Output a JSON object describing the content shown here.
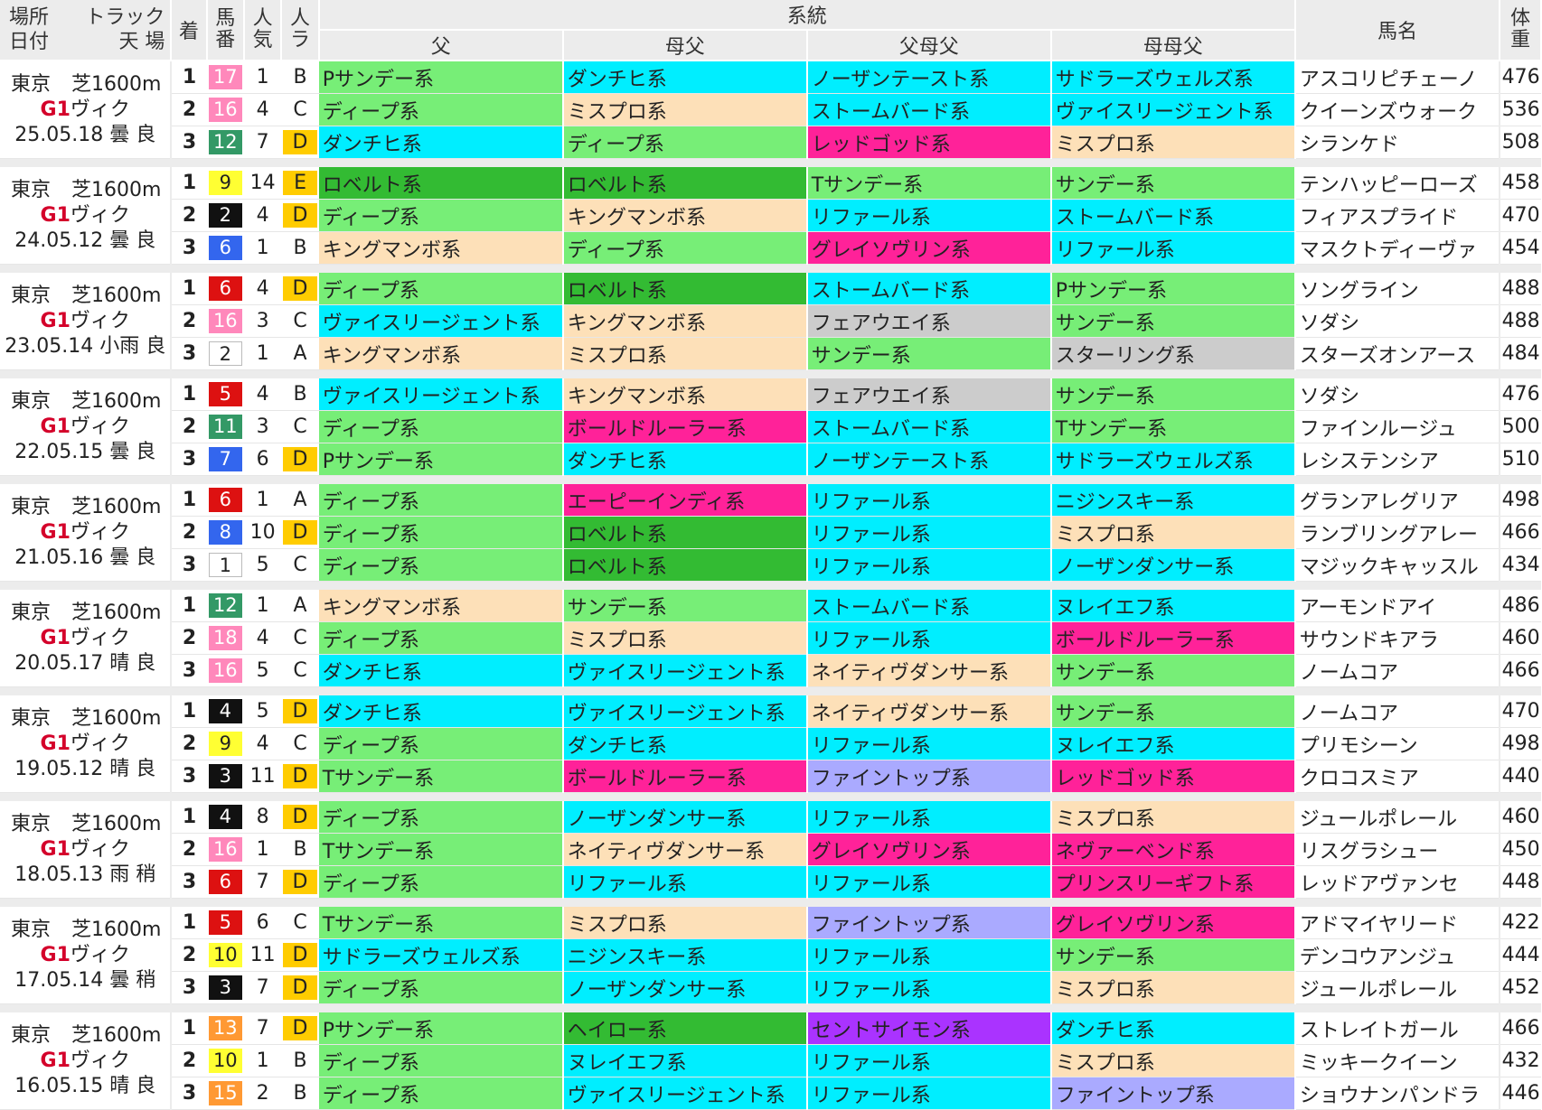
{
  "header": {
    "place": "場所",
    "track": "トラック",
    "date": "日付",
    "weather_ground": "天 場",
    "chaku": "着",
    "umaban": [
      "馬",
      "番"
    ],
    "ninki": [
      "人",
      "気"
    ],
    "nra": [
      "人",
      "ラ"
    ],
    "keito": "系統",
    "father": "父",
    "mother_father": "母父",
    "father_mother_father": "父母父",
    "mother_mother_father": "母母父",
    "horse_name": "馬名",
    "weight": [
      "体",
      "重"
    ]
  },
  "colors": {
    "ディープ系": "#77ee77",
    "ダンチヒ系": "#00eeff",
    "ロベルト系": "#33bb33",
    "キングマンボ系": "#fde0b8",
    "ヴァイスリージェント系": "#00eeff",
    "Pサンデー系": "#77ee77",
    "Tサンデー系": "#77ee77",
    "サドラーズウェルズ系": "#00eeff",
    "ミスプロ系": "#fde0b8",
    "ボールドルーラー系": "#ff2299",
    "エーピーインディ系": "#ff2299",
    "サンデー系": "#77ee77",
    "ネイティヴダンサー系": "#fde0b8",
    "ノーザンダンサー系": "#00eeff",
    "リファール系": "#00eeff",
    "ニジンスキー系": "#00eeff",
    "ヘイロー系": "#33bb33",
    "ヌレイエフ系": "#00eeff",
    "ノーザンテースト系": "#00eeff",
    "ストームバード系": "#00eeff",
    "レッドゴッド系": "#ff2299",
    "グレイソヴリン系": "#ff2299",
    "フェアウエイ系": "#cccccc",
    "スターリング系": "#cccccc",
    "ファイントップ系": "#aaaaff",
    "セントサイモン系": "#aa33ff",
    "ネヴァーベンド系": "#ff2299",
    "プリンスリーギフト系": "#ff2299"
  },
  "gate_colors": {
    "1": "#ffffff",
    "2": "#111111",
    "3": "#dd1111",
    "4": "#3366ee",
    "5": "#ffff33",
    "6": "#339966",
    "7": "#ff9933",
    "8": "#ff88bb"
  },
  "ra_color": "#ffcc00",
  "races": [
    {
      "place": "東京",
      "track": "芝1600m",
      "grade": "G1",
      "name": "ヴィク",
      "date": "25.05.18",
      "weather": "曇",
      "ground": "良",
      "rows": [
        {
          "chaku": "1",
          "uma": "17",
          "gate": "8",
          "ninki": "1",
          "ra": "B",
          "f": "Pサンデー系",
          "mf": "ダンチヒ系",
          "fmf": "ノーザンテースト系",
          "mmf": "サドラーズウェルズ系",
          "horse": "アスコリピチェーノ",
          "wt": "476"
        },
        {
          "chaku": "2",
          "uma": "16",
          "gate": "8",
          "ninki": "4",
          "ra": "C",
          "f": "ディープ系",
          "mf": "ミスプロ系",
          "fmf": "ストームバード系",
          "mmf": "ヴァイスリージェント系",
          "horse": "クイーンズウォーク",
          "wt": "536"
        },
        {
          "chaku": "3",
          "uma": "12",
          "gate": "6",
          "ninki": "7",
          "ra": "D",
          "f": "ダンチヒ系",
          "mf": "ディープ系",
          "fmf": "レッドゴッド系",
          "mmf": "ミスプロ系",
          "horse": "シランケド",
          "wt": "508"
        }
      ]
    },
    {
      "place": "東京",
      "track": "芝1600m",
      "grade": "G1",
      "name": "ヴィク",
      "date": "24.05.12",
      "weather": "曇",
      "ground": "良",
      "rows": [
        {
          "chaku": "1",
          "uma": "9",
          "gate": "5",
          "ninki": "14",
          "ra": "E",
          "f": "ロベルト系",
          "mf": "ロベルト系",
          "fmf": "Tサンデー系",
          "mmf": "サンデー系",
          "horse": "テンハッピーローズ",
          "wt": "458"
        },
        {
          "chaku": "2",
          "uma": "2",
          "gate": "2",
          "ninki": "4",
          "ra": "D",
          "f": "ディープ系",
          "mf": "キングマンボ系",
          "fmf": "リファール系",
          "mmf": "ストームバード系",
          "horse": "フィアスプライド",
          "wt": "470"
        },
        {
          "chaku": "3",
          "uma": "6",
          "gate": "4",
          "ninki": "1",
          "ra": "B",
          "f": "キングマンボ系",
          "mf": "ディープ系",
          "fmf": "グレイソヴリン系",
          "mmf": "リファール系",
          "horse": "マスクトディーヴァ",
          "wt": "454"
        }
      ]
    },
    {
      "place": "東京",
      "track": "芝1600m",
      "grade": "G1",
      "name": "ヴィク",
      "date": "23.05.14",
      "weather": "小雨",
      "ground": "良",
      "rows": [
        {
          "chaku": "1",
          "uma": "6",
          "gate": "3",
          "ninki": "4",
          "ra": "D",
          "f": "ディープ系",
          "mf": "ロベルト系",
          "fmf": "ストームバード系",
          "mmf": "Pサンデー系",
          "horse": "ソングライン",
          "wt": "488"
        },
        {
          "chaku": "2",
          "uma": "16",
          "gate": "8",
          "ninki": "3",
          "ra": "C",
          "f": "ヴァイスリージェント系",
          "mf": "キングマンボ系",
          "fmf": "フェアウエイ系",
          "mmf": "サンデー系",
          "horse": "ソダシ",
          "wt": "488"
        },
        {
          "chaku": "3",
          "uma": "2",
          "gate": "1",
          "ninki": "1",
          "ra": "A",
          "f": "キングマンボ系",
          "mf": "ミスプロ系",
          "fmf": "サンデー系",
          "mmf": "スターリング系",
          "horse": "スターズオンアース",
          "wt": "484"
        }
      ]
    },
    {
      "place": "東京",
      "track": "芝1600m",
      "grade": "G1",
      "name": "ヴィク",
      "date": "22.05.15",
      "weather": "曇",
      "ground": "良",
      "rows": [
        {
          "chaku": "1",
          "uma": "5",
          "gate": "3",
          "ninki": "4",
          "ra": "B",
          "f": "ヴァイスリージェント系",
          "mf": "キングマンボ系",
          "fmf": "フェアウエイ系",
          "mmf": "サンデー系",
          "horse": "ソダシ",
          "wt": "476"
        },
        {
          "chaku": "2",
          "uma": "11",
          "gate": "6",
          "ninki": "3",
          "ra": "C",
          "f": "ディープ系",
          "mf": "ボールドルーラー系",
          "fmf": "ストームバード系",
          "mmf": "Tサンデー系",
          "horse": "ファインルージュ",
          "wt": "500"
        },
        {
          "chaku": "3",
          "uma": "7",
          "gate": "4",
          "ninki": "6",
          "ra": "D",
          "f": "Pサンデー系",
          "mf": "ダンチヒ系",
          "fmf": "ノーザンテースト系",
          "mmf": "サドラーズウェルズ系",
          "horse": "レシステンシア",
          "wt": "510"
        }
      ]
    },
    {
      "place": "東京",
      "track": "芝1600m",
      "grade": "G1",
      "name": "ヴィク",
      "date": "21.05.16",
      "weather": "曇",
      "ground": "良",
      "rows": [
        {
          "chaku": "1",
          "uma": "6",
          "gate": "3",
          "ninki": "1",
          "ra": "A",
          "f": "ディープ系",
          "mf": "エーピーインディ系",
          "fmf": "リファール系",
          "mmf": "ニジンスキー系",
          "horse": "グランアレグリア",
          "wt": "498"
        },
        {
          "chaku": "2",
          "uma": "8",
          "gate": "4",
          "ninki": "10",
          "ra": "D",
          "f": "ディープ系",
          "mf": "ロベルト系",
          "fmf": "リファール系",
          "mmf": "ミスプロ系",
          "horse": "ランブリングアレー",
          "wt": "466"
        },
        {
          "chaku": "3",
          "uma": "1",
          "gate": "1",
          "ninki": "5",
          "ra": "C",
          "f": "ディープ系",
          "mf": "ロベルト系",
          "fmf": "リファール系",
          "mmf": "ノーザンダンサー系",
          "horse": "マジックキャッスル",
          "wt": "434"
        }
      ]
    },
    {
      "place": "東京",
      "track": "芝1600m",
      "grade": "G1",
      "name": "ヴィク",
      "date": "20.05.17",
      "weather": "晴",
      "ground": "良",
      "rows": [
        {
          "chaku": "1",
          "uma": "12",
          "gate": "6",
          "ninki": "1",
          "ra": "A",
          "f": "キングマンボ系",
          "mf": "サンデー系",
          "fmf": "ストームバード系",
          "mmf": "ヌレイエフ系",
          "horse": "アーモンドアイ",
          "wt": "486"
        },
        {
          "chaku": "2",
          "uma": "18",
          "gate": "8",
          "ninki": "4",
          "ra": "C",
          "f": "ディープ系",
          "mf": "ミスプロ系",
          "fmf": "リファール系",
          "mmf": "ボールドルーラー系",
          "horse": "サウンドキアラ",
          "wt": "460"
        },
        {
          "chaku": "3",
          "uma": "16",
          "gate": "8",
          "ninki": "5",
          "ra": "C",
          "f": "ダンチヒ系",
          "mf": "ヴァイスリージェント系",
          "fmf": "ネイティヴダンサー系",
          "mmf": "サンデー系",
          "horse": "ノームコア",
          "wt": "466"
        }
      ]
    },
    {
      "place": "東京",
      "track": "芝1600m",
      "grade": "G1",
      "name": "ヴィク",
      "date": "19.05.12",
      "weather": "晴",
      "ground": "良",
      "rows": [
        {
          "chaku": "1",
          "uma": "4",
          "gate": "2",
          "ninki": "5",
          "ra": "D",
          "f": "ダンチヒ系",
          "mf": "ヴァイスリージェント系",
          "fmf": "ネイティヴダンサー系",
          "mmf": "サンデー系",
          "horse": "ノームコア",
          "wt": "470"
        },
        {
          "chaku": "2",
          "uma": "9",
          "gate": "5",
          "ninki": "4",
          "ra": "C",
          "f": "ディープ系",
          "mf": "ダンチヒ系",
          "fmf": "リファール系",
          "mmf": "ヌレイエフ系",
          "horse": "プリモシーン",
          "wt": "498"
        },
        {
          "chaku": "3",
          "uma": "3",
          "gate": "2",
          "ninki": "11",
          "ra": "D",
          "f": "Tサンデー系",
          "mf": "ボールドルーラー系",
          "fmf": "ファイントップ系",
          "mmf": "レッドゴッド系",
          "horse": "クロコスミア",
          "wt": "440"
        }
      ]
    },
    {
      "place": "東京",
      "track": "芝1600m",
      "grade": "G1",
      "name": "ヴィク",
      "date": "18.05.13",
      "weather": "雨",
      "ground": "稍",
      "rows": [
        {
          "chaku": "1",
          "uma": "4",
          "gate": "2",
          "ninki": "8",
          "ra": "D",
          "f": "ディープ系",
          "mf": "ノーザンダンサー系",
          "fmf": "リファール系",
          "mmf": "ミスプロ系",
          "horse": "ジュールポレール",
          "wt": "460"
        },
        {
          "chaku": "2",
          "uma": "16",
          "gate": "8",
          "ninki": "1",
          "ra": "B",
          "f": "Tサンデー系",
          "mf": "ネイティヴダンサー系",
          "fmf": "グレイソヴリン系",
          "mmf": "ネヴァーベンド系",
          "horse": "リスグラシュー",
          "wt": "450"
        },
        {
          "chaku": "3",
          "uma": "6",
          "gate": "3",
          "ninki": "7",
          "ra": "D",
          "f": "ディープ系",
          "mf": "リファール系",
          "fmf": "リファール系",
          "mmf": "プリンスリーギフト系",
          "horse": "レッドアヴァンセ",
          "wt": "448"
        }
      ]
    },
    {
      "place": "東京",
      "track": "芝1600m",
      "grade": "G1",
      "name": "ヴィク",
      "date": "17.05.14",
      "weather": "曇",
      "ground": "稍",
      "rows": [
        {
          "chaku": "1",
          "uma": "5",
          "gate": "3",
          "ninki": "6",
          "ra": "C",
          "f": "Tサンデー系",
          "mf": "ミスプロ系",
          "fmf": "ファイントップ系",
          "mmf": "グレイソヴリン系",
          "horse": "アドマイヤリード",
          "wt": "422"
        },
        {
          "chaku": "2",
          "uma": "10",
          "gate": "5",
          "ninki": "11",
          "ra": "D",
          "f": "サドラーズウェルズ系",
          "mf": "ニジンスキー系",
          "fmf": "リファール系",
          "mmf": "サンデー系",
          "horse": "デンコウアンジュ",
          "wt": "444"
        },
        {
          "chaku": "3",
          "uma": "3",
          "gate": "2",
          "ninki": "7",
          "ra": "D",
          "f": "ディープ系",
          "mf": "ノーザンダンサー系",
          "fmf": "リファール系",
          "mmf": "ミスプロ系",
          "horse": "ジュールポレール",
          "wt": "452"
        }
      ]
    },
    {
      "place": "東京",
      "track": "芝1600m",
      "grade": "G1",
      "name": "ヴィク",
      "date": "16.05.15",
      "weather": "晴",
      "ground": "良",
      "rows": [
        {
          "chaku": "1",
          "uma": "13",
          "gate": "7",
          "ninki": "7",
          "ra": "D",
          "f": "Pサンデー系",
          "mf": "ヘイロー系",
          "fmf": "セントサイモン系",
          "mmf": "ダンチヒ系",
          "horse": "ストレイトガール",
          "wt": "466"
        },
        {
          "chaku": "2",
          "uma": "10",
          "gate": "5",
          "ninki": "1",
          "ra": "B",
          "f": "ディープ系",
          "mf": "ヌレイエフ系",
          "fmf": "リファール系",
          "mmf": "ミスプロ系",
          "horse": "ミッキークイーン",
          "wt": "432"
        },
        {
          "chaku": "3",
          "uma": "15",
          "gate": "7",
          "ninki": "2",
          "ra": "B",
          "f": "ディープ系",
          "mf": "ヴァイスリージェント系",
          "fmf": "リファール系",
          "mmf": "ファイントップ系",
          "horse": "ショウナンパンドラ",
          "wt": "446"
        }
      ]
    }
  ]
}
